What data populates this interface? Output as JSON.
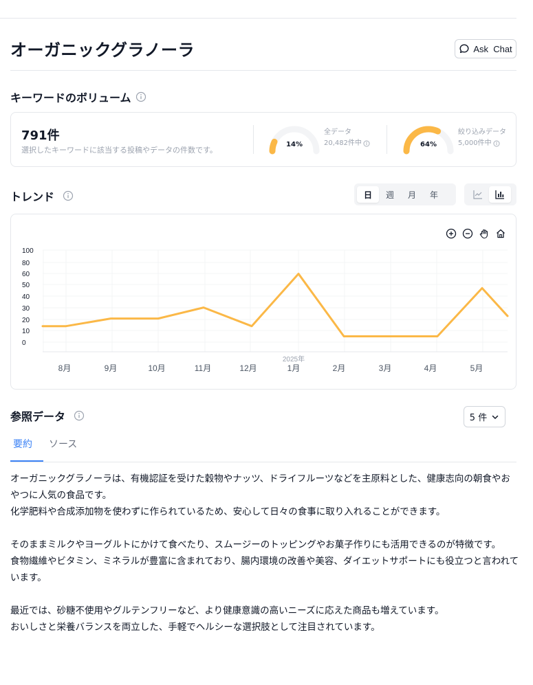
{
  "title": "オーガニックグラノーラ",
  "ask_chat": {
    "icon": "chat-bubble-icon",
    "label": "Ask  Chat"
  },
  "volume": {
    "heading": "キーワードのボリューム",
    "count": "791件",
    "description": "選択したキーワードに該当する投稿やデータの件数です。",
    "gauges": [
      {
        "percent_label": "14%",
        "fraction": 0.14,
        "name": "全データ",
        "total": "20,482件中"
      },
      {
        "percent_label": "64%",
        "fraction": 0.64,
        "name": "絞り込みデータ",
        "total": "5,000件中"
      }
    ],
    "accent": "#fbb847",
    "track": "#f3f4f6"
  },
  "trend": {
    "heading": "トレンド",
    "periods": [
      "日",
      "週",
      "月",
      "年"
    ],
    "active_period": "日",
    "chart_types": [
      "line-chart-icon",
      "bar-chart-icon"
    ],
    "tools": [
      "zoom-in-icon",
      "zoom-out-icon",
      "pan-hand-icon",
      "home-icon"
    ]
  },
  "chart_data": {
    "type": "line",
    "color": "#fbb847",
    "y_ticks": [
      "100",
      "80",
      "60",
      "50",
      "40",
      "30",
      "20",
      "10",
      "0"
    ],
    "x": [
      "8月",
      "9月",
      "10月",
      "11月",
      "12月",
      "1月",
      "2月",
      "3月",
      "4月",
      "5月"
    ],
    "year_marker": "2025年",
    "points": [
      {
        "x": "start",
        "y": 10
      },
      {
        "x": "8月",
        "y": 10
      },
      {
        "x": "9月",
        "y": 19
      },
      {
        "x": "10月",
        "y": 19
      },
      {
        "x": "11月",
        "y": 32
      },
      {
        "x": "12月",
        "y": 10
      },
      {
        "x": "1月",
        "y": 72
      },
      {
        "x": "2月",
        "y": -2
      },
      {
        "x": "3月",
        "y": -2
      },
      {
        "x": "4月",
        "y": -2
      },
      {
        "x": "5月",
        "y": 55
      },
      {
        "x": "end",
        "y": 22
      }
    ]
  },
  "reference": {
    "heading": "参照データ",
    "count_select": "5 件",
    "tabs": [
      "要約",
      "ソース"
    ],
    "active_tab": "要約",
    "paragraphs": [
      "オーガニックグラノーラは、有機認証を受けた穀物やナッツ、ドライフルーツなどを主原料とした、健康志向の朝食やおやつに人気の食品です。",
      "化学肥料や合成添加物を使わずに作られているため、安心して日々の食事に取り入れることができます。",
      "",
      "そのままミルクやヨーグルトにかけて食べたり、スムージーのトッピングやお菓子作りにも活用できるのが特徴です。",
      "食物繊維やビタミン、ミネラルが豊富に含まれており、腸内環境の改善や美容、ダイエットサポートにも役立つと言われています。",
      "",
      "最近では、砂糖不使用やグルテンフリーなど、より健康意識の高いニーズに応えた商品も増えています。",
      "おいしさと栄養バランスを両立した、手軽でヘルシーな選択肢として注目されています。"
    ]
  }
}
